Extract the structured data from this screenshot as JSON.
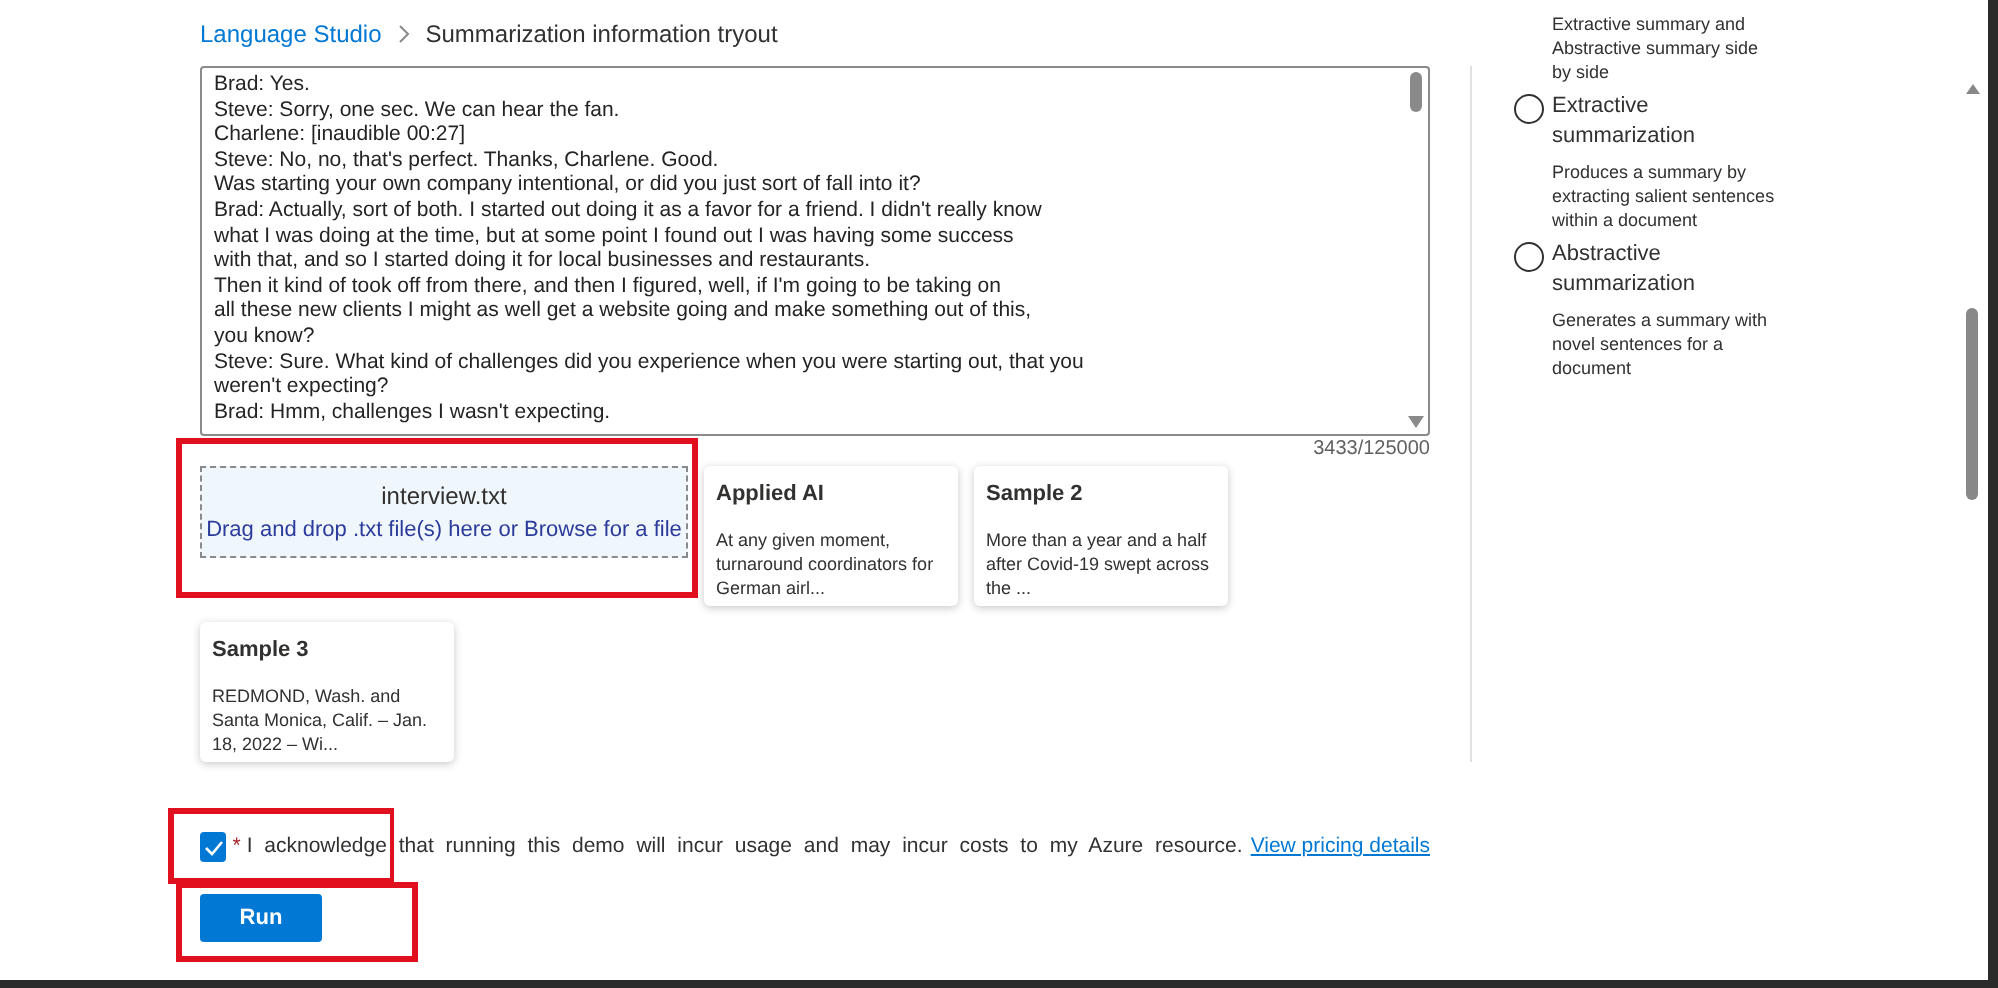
{
  "breadcrumb": [
    {
      "label": "Language Studio",
      "kind": "link"
    },
    {
      "label": "Summarization information tryout",
      "kind": "current"
    }
  ],
  "input_text": {
    "lines": [
      "Brad: Yes.",
      "Steve: Sorry, one sec. We can hear the fan.",
      "Charlene: [inaudible 00:27]",
      "Steve: No, no, that's perfect. Thanks, Charlene. Good.",
      "Was starting your own company intentional, or did you just sort of fall into it?",
      "Brad: Actually, sort of both. I started out doing it as a favor for a friend. I didn't really know",
      "what I was doing at the time, but at some point I found out I was having some success",
      "with that, and so I started doing it for local businesses and restaurants.",
      "Then it kind of took off from there, and then I figured, well, if I'm going to be taking on",
      "all these new clients I might as well get a website going and make something out of this,",
      "you know?",
      "Steve: Sure. What kind of challenges did you experience when you were starting out, that you",
      "weren't expecting?",
      "Brad: Hmm, challenges I wasn't expecting."
    ],
    "counter": "3433/125000"
  },
  "upload": {
    "file_name": "interview.txt",
    "hint": "Drag and drop .txt file(s) here or Browse for a file"
  },
  "samples": [
    {
      "title": "Applied AI",
      "excerpt": "At any given moment, turnaround coordinators for German airl..."
    },
    {
      "title": "Sample 2",
      "excerpt": "More than a year and a half after Covid-19 swept across the ..."
    },
    {
      "title": "Sample 3",
      "excerpt": "REDMOND, Wash. and Santa Monica, Calif. – Jan. 18, 2022 – Wi..."
    }
  ],
  "options": [
    {
      "description": "Extractive summary and Abstractive summary side by side"
    },
    {
      "label": "Extractive summarization",
      "selected": false,
      "description": "Produces a summary by extracting salient sentences within a document"
    },
    {
      "label": "Abstractive summarization",
      "selected": false,
      "description": "Generates a summary with novel sentences for a document"
    }
  ],
  "acknowledge": {
    "checked": true,
    "required_mark": "*",
    "text": "I acknowledge that running this demo will incur usage and may incur costs to my Azure resource.",
    "link": "View pricing details"
  },
  "run_button": "Run"
}
